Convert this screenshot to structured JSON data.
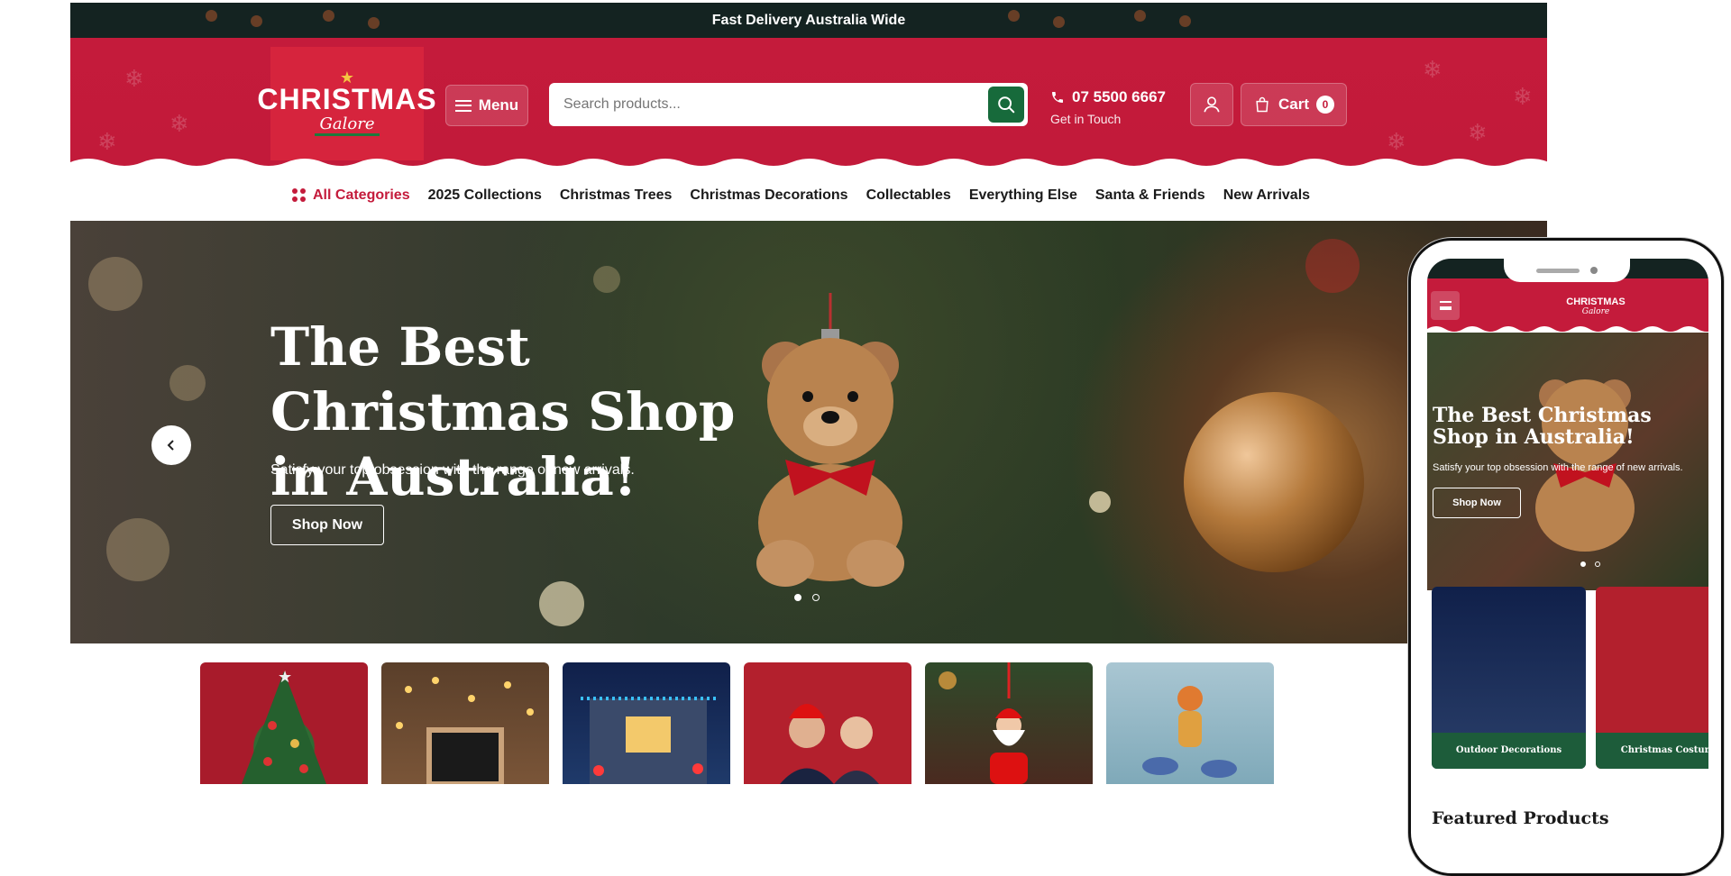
{
  "announcement": "Fast Delivery Australia Wide",
  "logo": {
    "line1": "CHRISTMAS",
    "line2": "Galore"
  },
  "header": {
    "menu_label": "Menu",
    "search_placeholder": "Search products...",
    "phone_number": "07 5500 6667",
    "phone_caption": "Get in Touch",
    "cart_label": "Cart",
    "cart_count": "0"
  },
  "nav": {
    "all_categories": "All Categories",
    "items": [
      "2025 Collections",
      "Christmas Trees",
      "Christmas Decorations",
      "Collectables",
      "Everything Else",
      "Santa & Friends",
      "New Arrivals"
    ]
  },
  "hero": {
    "title": "The Best Christmas Shop in Australia!",
    "subtitle": "Satisfy your top obsession with the range of new arrivals.",
    "cta": "Shop Now",
    "slides": 2,
    "active_slide": 1
  },
  "categories": [
    {
      "name": "christmas-tree",
      "color": "#a81b2b"
    },
    {
      "name": "fairy-lights",
      "color": "#5a3f2a"
    },
    {
      "name": "outdoor-lights",
      "color": "#1d3a6a"
    },
    {
      "name": "christmas-costumes",
      "color": "#b3202d"
    },
    {
      "name": "santa-ornament",
      "color": "#2f4a2a"
    },
    {
      "name": "inflatables",
      "color": "#8fb6c4"
    }
  ],
  "mobile": {
    "hero_title": "The Best Christmas Shop in Australia!",
    "hero_subtitle": "Satisfy your top obsession with the range of new arrivals.",
    "cta": "Shop Now",
    "categories": [
      "Outdoor Decorations",
      "Christmas Costumes"
    ],
    "featured_heading": "Featured Products"
  },
  "colors": {
    "brand_red": "#c41b3b",
    "dark_green": "#176a3b",
    "topbar": "#142321"
  }
}
